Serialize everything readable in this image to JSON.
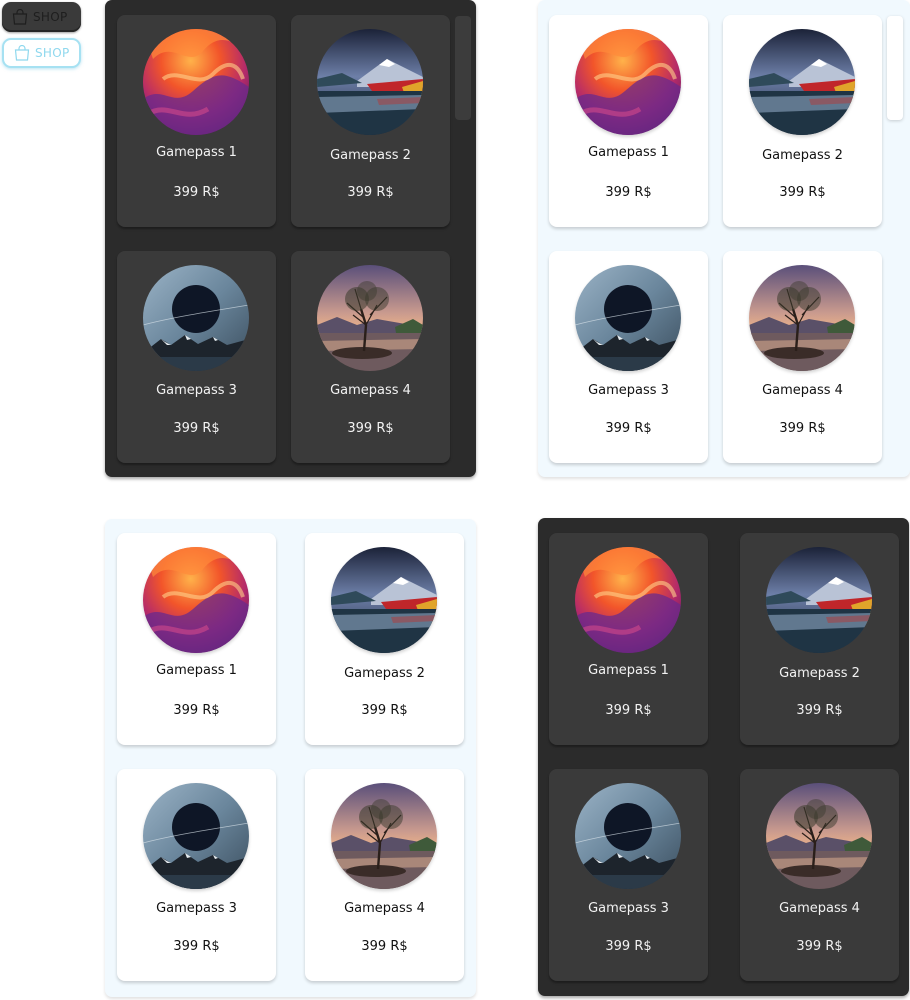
{
  "shop_buttons": [
    {
      "label": "SHOP",
      "theme": "dark"
    },
    {
      "label": "SHOP",
      "theme": "light"
    }
  ],
  "accent_color": "#a6e1f2",
  "panels": [
    {
      "theme": "dark",
      "has_scrollbar": true,
      "items": [
        {
          "name": "Gamepass 1",
          "price": "399 R$",
          "image": "abstract-lava"
        },
        {
          "name": "Gamepass 2",
          "price": "399 R$",
          "image": "mountain-lake"
        },
        {
          "name": "Gamepass 3",
          "price": "399 R$",
          "image": "eclipse-mountains"
        },
        {
          "name": "Gamepass 4",
          "price": "399 R$",
          "image": "lone-tree"
        }
      ]
    },
    {
      "theme": "light",
      "has_scrollbar": true,
      "items": [
        {
          "name": "Gamepass 1",
          "price": "399 R$",
          "image": "abstract-lava"
        },
        {
          "name": "Gamepass 2",
          "price": "399 R$",
          "image": "mountain-lake"
        },
        {
          "name": "Gamepass 3",
          "price": "399 R$",
          "image": "eclipse-mountains"
        },
        {
          "name": "Gamepass 4",
          "price": "399 R$",
          "image": "lone-tree"
        }
      ]
    },
    {
      "theme": "light",
      "has_scrollbar": false,
      "items": [
        {
          "name": "Gamepass 1",
          "price": "399 R$",
          "image": "abstract-lava"
        },
        {
          "name": "Gamepass 2",
          "price": "399 R$",
          "image": "mountain-lake"
        },
        {
          "name": "Gamepass 3",
          "price": "399 R$",
          "image": "eclipse-mountains"
        },
        {
          "name": "Gamepass 4",
          "price": "399 R$",
          "image": "lone-tree"
        }
      ]
    },
    {
      "theme": "dark",
      "has_scrollbar": false,
      "items": [
        {
          "name": "Gamepass 1",
          "price": "399 R$",
          "image": "abstract-lava"
        },
        {
          "name": "Gamepass 2",
          "price": "399 R$",
          "image": "mountain-lake"
        },
        {
          "name": "Gamepass 3",
          "price": "399 R$",
          "image": "eclipse-mountains"
        },
        {
          "name": "Gamepass 4",
          "price": "399 R$",
          "image": "lone-tree"
        }
      ]
    }
  ]
}
